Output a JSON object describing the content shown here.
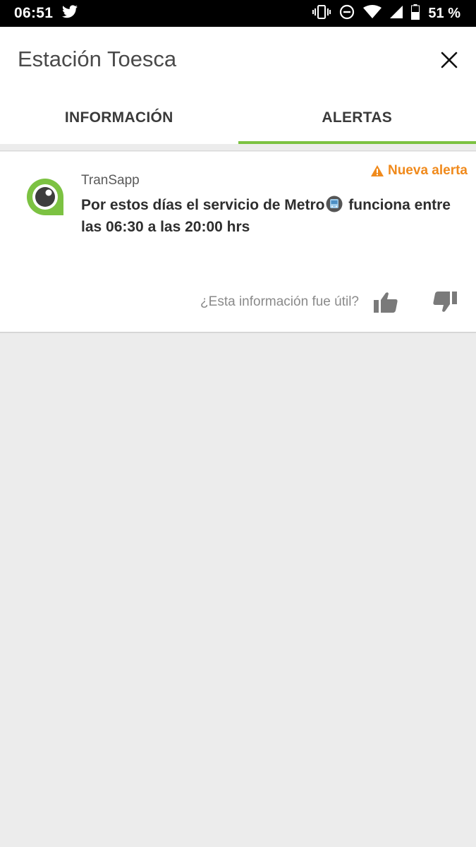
{
  "status_bar": {
    "time": "06:51",
    "battery": "51 %",
    "icons": [
      "twitter-icon",
      "vibrate-icon",
      "do-not-disturb-icon",
      "wifi-icon",
      "signal-icon",
      "battery-icon"
    ]
  },
  "header": {
    "title": "Estación Toesca",
    "close_icon": "close-icon"
  },
  "tabs": [
    {
      "label": "INFORMACIÓN",
      "active": false
    },
    {
      "label": "ALERTAS",
      "active": true
    }
  ],
  "alert": {
    "source": "TranSapp",
    "badge": "Nueva alerta",
    "message_part1": "Por estos días el servicio de Metro",
    "message_part2": " funciona entre las 06:30 a las 20:00 hrs",
    "feedback_question": "¿Esta información fue útil?"
  },
  "colors": {
    "accent_green": "#7cc242",
    "badge_orange": "#f08a1c",
    "background": "#ececec"
  }
}
